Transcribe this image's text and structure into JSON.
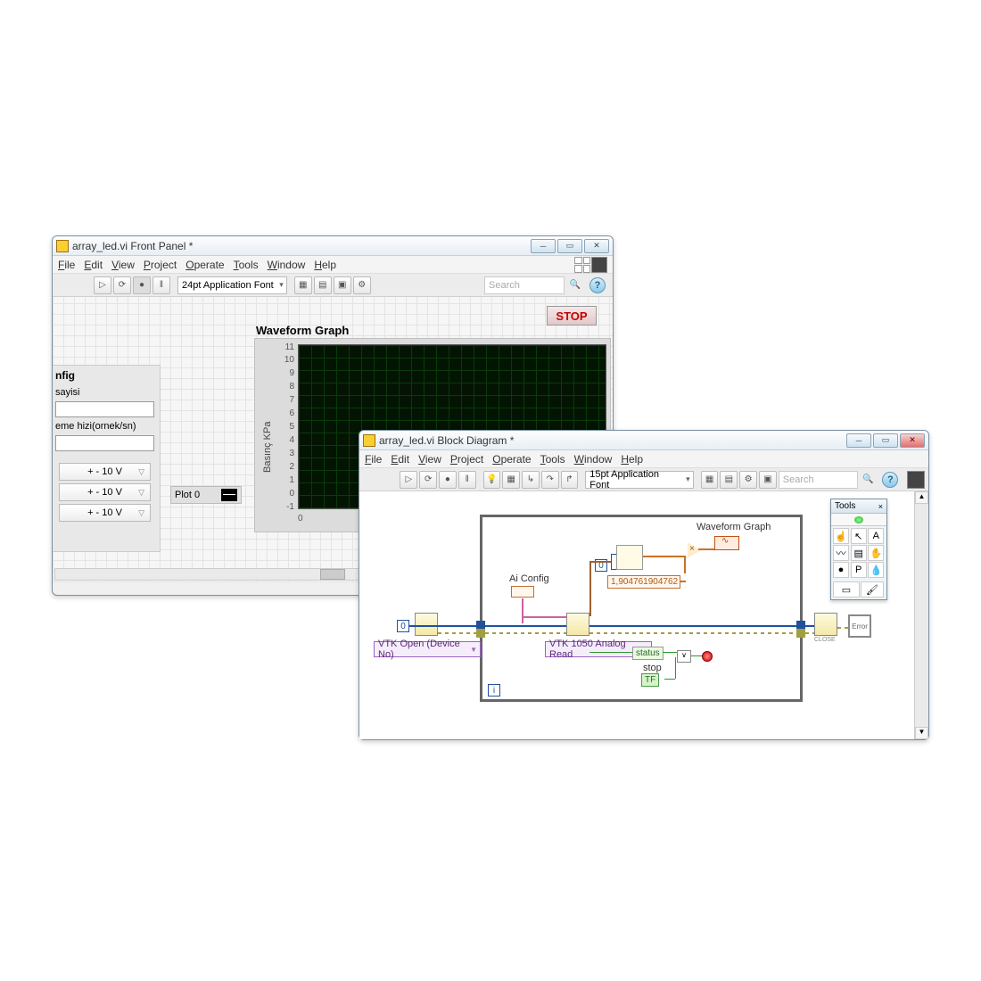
{
  "windows": {
    "frontPanel": {
      "title": "array_led.vi Front Panel *",
      "menu": [
        "File",
        "Edit",
        "View",
        "Project",
        "Operate",
        "Tools",
        "Window",
        "Help"
      ],
      "font": "24pt Application Font",
      "search_placeholder": "Search",
      "stop_label": "STOP",
      "graph_title": "Waveform Graph",
      "yaxis_label": "Basınç KPa",
      "yticks": [
        "11",
        "10",
        "9",
        "8",
        "7",
        "6",
        "5",
        "4",
        "3",
        "2",
        "1",
        "0",
        "-1"
      ],
      "xtick0": "0",
      "legend_label": "Plot 0",
      "config": {
        "title_partial": "nfig",
        "row1": "sayisi",
        "row2": "eme hizi(ornek/sn)",
        "range": "+ - 10 V"
      }
    },
    "blockDiagram": {
      "title": "array_led.vi Block Diagram *",
      "menu": [
        "File",
        "Edit",
        "View",
        "Project",
        "Operate",
        "Tools",
        "Window",
        "Help"
      ],
      "font": "15pt Application Font",
      "search_placeholder": "Search",
      "tools_title": "Tools",
      "labels": {
        "ai_config": "Ai Config",
        "waveform_graph": "Waveform Graph",
        "constant": "1,904761904762",
        "blue0a": "0",
        "blue0b": "0",
        "blue_i": "i",
        "vtk_open": "VTK Open (Device No)",
        "vtk_read": "VTK 1050 Analog Read",
        "status": "status",
        "stop": "stop",
        "stop_tf": "TF",
        "error": "Error",
        "close": "CLOSE"
      }
    }
  }
}
